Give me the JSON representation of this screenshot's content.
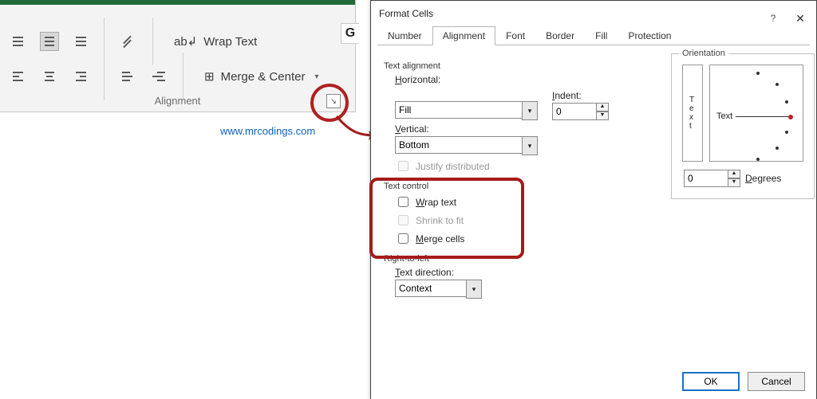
{
  "ribbon": {
    "group_label": "Alignment",
    "wrap_text": "Wrap Text",
    "merge_center": "Merge & Center"
  },
  "url": "www.mrcodings.com",
  "g_label": "G",
  "dialog": {
    "title": "Format Cells",
    "tabs": [
      "Number",
      "Alignment",
      "Font",
      "Border",
      "Fill",
      "Protection"
    ],
    "active_tab": 1,
    "text_alignment_label": "Text alignment",
    "horizontal_label": "Horizontal:",
    "horizontal_value": "Fill",
    "indent_label": "Indent:",
    "indent_value": "0",
    "vertical_label": "Vertical:",
    "vertical_value": "Bottom",
    "justify_label": "Justify distributed",
    "text_control_label": "Text control",
    "wrap_label": "Wrap text",
    "shrink_label": "Shrink to fit",
    "merge_label": "Merge cells",
    "rtl_label": "Right-to-left",
    "direction_label": "Text direction:",
    "direction_value": "Context",
    "orientation_label": "Orientation",
    "orientation_text": "Text",
    "orientation_side": "T e x t",
    "degrees_value": "0",
    "degrees_label": "Degrees",
    "ok": "OK",
    "cancel": "Cancel"
  }
}
